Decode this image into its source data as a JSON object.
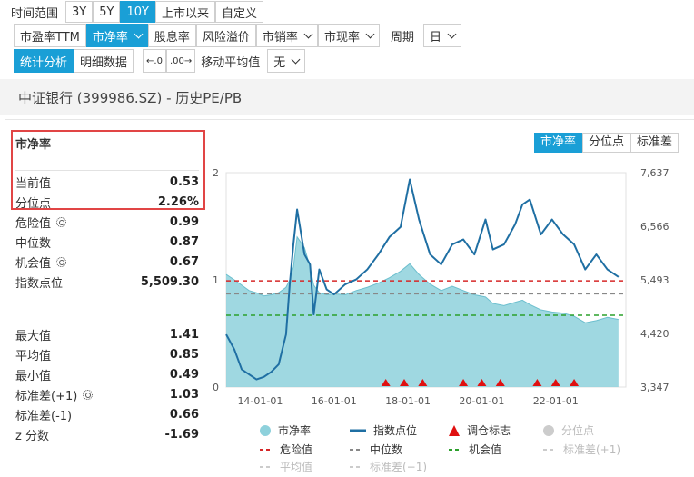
{
  "toolbar": {
    "range_label": "时间范围",
    "ranges": [
      "3Y",
      "5Y",
      "10Y",
      "上市以来",
      "自定义"
    ],
    "metrics": [
      "市盈率TTM",
      "市净率",
      "股息率",
      "风险溢价",
      "市销率",
      "市现率"
    ],
    "period_label": "周期",
    "period_value": "日",
    "view_tabs": [
      "统计分析",
      "明细数据"
    ],
    "ma_label": "移动平均值",
    "ma_value": "无"
  },
  "page_title": "中证银行 (399986.SZ) - 历史PE/PB",
  "stats": {
    "heading": "市净率",
    "current_label": "当前值",
    "current_value": "0.53",
    "pct_label": "分位点",
    "pct_value": "2.26%",
    "danger_label": "危险值",
    "danger_value": "0.99",
    "median_label": "中位数",
    "median_value": "0.87",
    "chance_label": "机会值",
    "chance_value": "0.67",
    "index_label": "指数点位",
    "index_value": "5,509.30",
    "max_label": "最大值",
    "max_value": "1.41",
    "avg_label": "平均值",
    "avg_value": "0.85",
    "min_label": "最小值",
    "min_value": "0.49",
    "sd_plus_label": "标准差(+1)",
    "sd_plus_value": "1.03",
    "sd_minus_label": "标准差(-1)",
    "sd_minus_value": "0.66",
    "z_label": "z 分数",
    "z_value": "-1.69"
  },
  "chart_tabs": [
    "市净率",
    "分位点",
    "标准差"
  ],
  "legend": {
    "pb": "市净率",
    "index": "指数点位",
    "rebalance": "调仓标志",
    "percentile": "分位点",
    "danger": "危险值",
    "median": "中位数",
    "chance": "机会值",
    "sd_plus": "标准差(+1)",
    "average": "平均值",
    "sd_minus": "标准差(−1)"
  },
  "colors": {
    "accent": "#1a9fd6",
    "area": "#8ed1dc",
    "index_line": "#1f6fa3",
    "danger": "#d62728",
    "median": "#888888",
    "chance": "#2ca02c",
    "marker": "#e01010"
  },
  "chart_data": {
    "type": "area",
    "x_tick_labels": [
      "14-01-01",
      "16-01-01",
      "18-01-01",
      "20-01-01",
      "22-01-01"
    ],
    "left_axis": {
      "ticks": [
        "2",
        "1",
        "0"
      ],
      "ylim": [
        0,
        2
      ]
    },
    "right_axis": {
      "ticks": [
        "7,637",
        "6,566",
        "5,493",
        "4,420",
        "3,347"
      ],
      "ylim": [
        3347,
        7637
      ]
    },
    "x": [
      2013.08,
      2013.3,
      2013.5,
      2013.7,
      2013.9,
      2014.1,
      2014.3,
      2014.5,
      2014.7,
      2014.8,
      2014.9,
      2015.0,
      2015.2,
      2015.35,
      2015.45,
      2015.6,
      2015.8,
      2016.0,
      2016.3,
      2016.6,
      2016.9,
      2017.2,
      2017.5,
      2017.8,
      2018.05,
      2018.3,
      2018.6,
      2018.9,
      2019.2,
      2019.5,
      2019.8,
      2020.1,
      2020.3,
      2020.6,
      2020.9,
      2021.1,
      2021.3,
      2021.6,
      2021.9,
      2022.2,
      2022.5,
      2022.8,
      2023.1,
      2023.4,
      2023.7
    ],
    "series": [
      {
        "name": "市净率",
        "values": [
          1.05,
          1.0,
          0.95,
          0.9,
          0.88,
          0.85,
          0.86,
          0.88,
          0.93,
          1.0,
          1.12,
          1.4,
          1.3,
          1.12,
          0.95,
          0.88,
          0.86,
          0.87,
          0.86,
          0.9,
          0.93,
          0.97,
          1.02,
          1.08,
          1.15,
          1.05,
          0.96,
          0.9,
          0.94,
          0.9,
          0.86,
          0.84,
          0.78,
          0.76,
          0.79,
          0.81,
          0.77,
          0.72,
          0.7,
          0.69,
          0.66,
          0.6,
          0.62,
          0.65,
          0.63
        ]
      },
      {
        "name": "指数点位",
        "values": [
          4400,
          4100,
          3700,
          3600,
          3500,
          3550,
          3650,
          3800,
          4400,
          5400,
          6200,
          6900,
          6000,
          5800,
          4800,
          5700,
          5300,
          5200,
          5400,
          5500,
          5700,
          6000,
          6350,
          6550,
          7500,
          6700,
          6000,
          5800,
          6200,
          6300,
          6000,
          6700,
          6100,
          6200,
          6600,
          7000,
          7100,
          6400,
          6700,
          6400,
          6200,
          5700,
          6000,
          5700,
          5550
        ]
      }
    ],
    "reference_lines": {
      "danger": 0.99,
      "median": 0.87,
      "chance": 0.67
    },
    "rebalance_x": [
      2017.4,
      2017.9,
      2018.4,
      2019.5,
      2020.0,
      2020.5,
      2021.5,
      2022.0,
      2022.5
    ],
    "xlim": [
      2013.08,
      2023.9
    ]
  }
}
